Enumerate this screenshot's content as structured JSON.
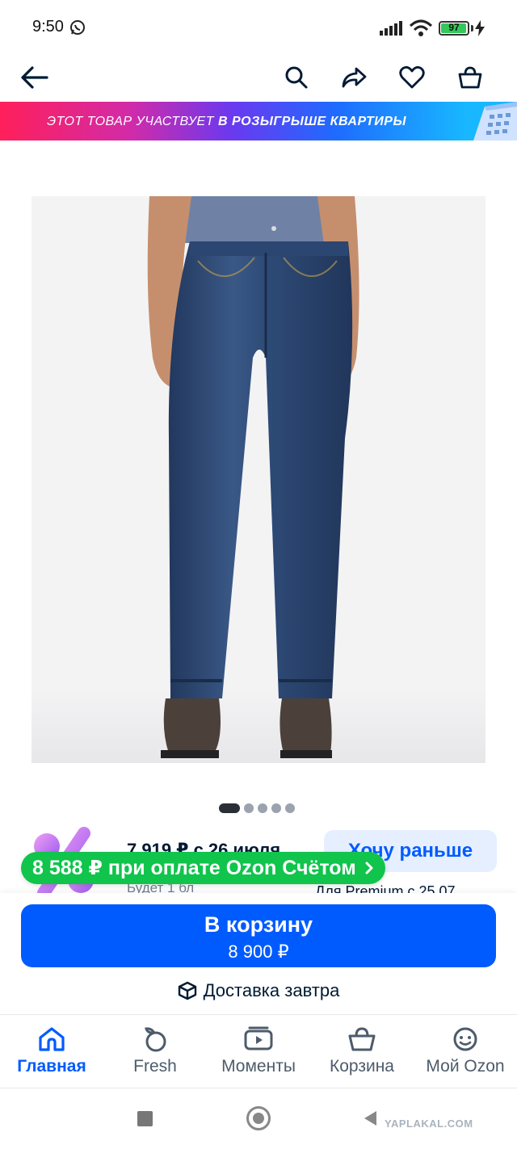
{
  "status_bar": {
    "time": "9:50",
    "battery_level": "97",
    "battery_fraction": 0.97
  },
  "top_nav": {
    "icons": [
      "back-arrow-icon",
      "search-icon",
      "share-icon",
      "heart-icon",
      "basket-icon"
    ]
  },
  "promo_banner": {
    "text_regular": "ЭТОТ ТОВАР УЧАСТВУЕТ ",
    "text_bold": "В РОЗЫГРЫШЕ КВАРТИРЫ"
  },
  "gallery": {
    "image_count": 5,
    "active_index": 0
  },
  "price_block": {
    "future_price": "7 919 ₽ с 26 июля",
    "future_sub": "Будет 1 бл",
    "want_earlier_label": "Хочу раньше",
    "premium_note": "Для Premium с 25.07",
    "ozon_pay_label": "8 588 ₽  при оплате Ozon Счётом"
  },
  "bottom_panel": {
    "cart_label": "В корзину",
    "cart_price": "8 900 ₽",
    "delivery_label": "Доставка завтра"
  },
  "tabbar": {
    "tabs": [
      {
        "label": "Главная",
        "icon": "home-icon",
        "active": true
      },
      {
        "label": "Fresh",
        "icon": "fresh-icon",
        "active": false
      },
      {
        "label": "Моменты",
        "icon": "moments-icon",
        "active": false
      },
      {
        "label": "Корзина",
        "icon": "cart-icon",
        "active": false
      },
      {
        "label": "Мой Ozon",
        "icon": "profile-icon",
        "active": false
      }
    ]
  },
  "watermark": "YAPLAKAL.COM",
  "colors": {
    "accent": "#005bff",
    "ozon_green": "#10c44c",
    "text": "#001a34"
  }
}
